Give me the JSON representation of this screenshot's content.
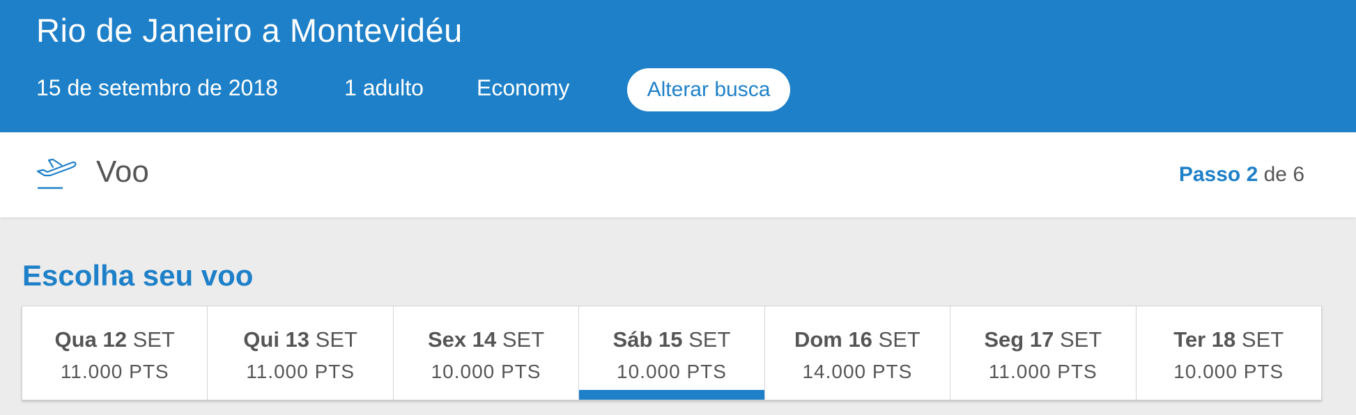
{
  "header": {
    "title": "Rio de Janeiro a Montevidéu",
    "date": "15 de setembro de 2018",
    "passengers": "1 adulto",
    "cabin": "Economy",
    "change_label": "Alterar busca"
  },
  "stepbar": {
    "icon": "plane-takeoff-icon",
    "step_name": "Voo",
    "step_prefix": "Passo 2",
    "step_suffix": "de 6"
  },
  "section_title": "Escolha seu voo",
  "dates": [
    {
      "weekday_day": "Qua 12",
      "month": "SET",
      "price": "11.000 PTS",
      "selected": false
    },
    {
      "weekday_day": "Qui 13",
      "month": "SET",
      "price": "11.000 PTS",
      "selected": false
    },
    {
      "weekday_day": "Sex 14",
      "month": "SET",
      "price": "10.000 PTS",
      "selected": false
    },
    {
      "weekday_day": "Sáb 15",
      "month": "SET",
      "price": "10.000 PTS",
      "selected": true
    },
    {
      "weekday_day": "Dom 16",
      "month": "SET",
      "price": "14.000 PTS",
      "selected": false
    },
    {
      "weekday_day": "Seg 17",
      "month": "SET",
      "price": "11.000 PTS",
      "selected": false
    },
    {
      "weekday_day": "Ter 18",
      "month": "SET",
      "price": "10.000 PTS",
      "selected": false
    }
  ],
  "colors": {
    "brand_blue": "#1e80c8",
    "text_gray": "#555555",
    "page_bg": "#ececec"
  }
}
